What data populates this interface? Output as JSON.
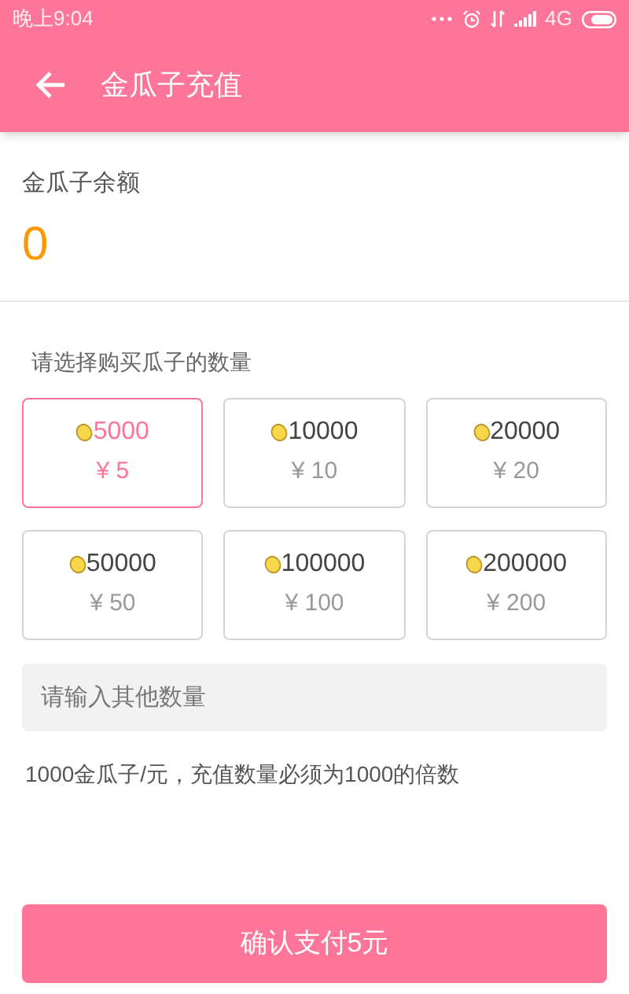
{
  "status_bar": {
    "time": "晚上9:04",
    "network": "4G"
  },
  "header": {
    "title": "金瓜子充值"
  },
  "balance": {
    "label": "金瓜子余额",
    "value": "0"
  },
  "packages": {
    "label": "请选择购买瓜子的数量",
    "items": [
      {
        "amount": "5000",
        "price": "¥ 5",
        "selected": true
      },
      {
        "amount": "10000",
        "price": "¥ 10",
        "selected": false
      },
      {
        "amount": "20000",
        "price": "¥ 20",
        "selected": false
      },
      {
        "amount": "50000",
        "price": "¥ 50",
        "selected": false
      },
      {
        "amount": "100000",
        "price": "¥ 100",
        "selected": false
      },
      {
        "amount": "200000",
        "price": "¥ 200",
        "selected": false
      }
    ]
  },
  "custom_amount": {
    "placeholder": "请输入其他数量"
  },
  "note": "1000金瓜子/元，充值数量必须为1000的倍数",
  "confirm_button": "确认支付5元"
}
